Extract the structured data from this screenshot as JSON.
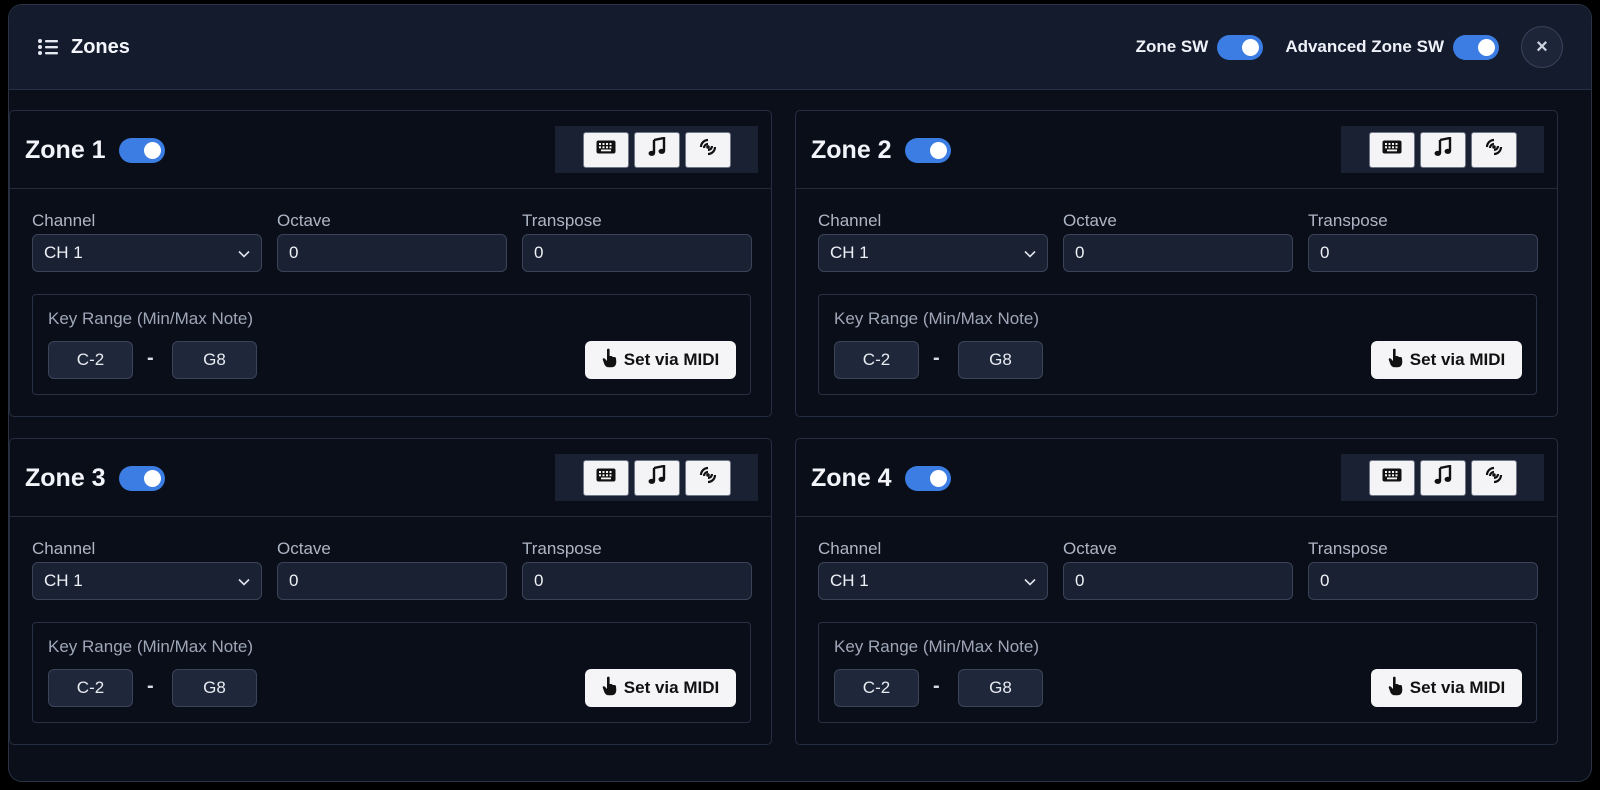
{
  "header": {
    "title": "Zones",
    "zone_sw_label": "Zone SW",
    "zone_sw_on": true,
    "advanced_sw_label": "Advanced Zone SW",
    "advanced_sw_on": true,
    "close_label": "×"
  },
  "labels": {
    "channel": "Channel",
    "octave": "Octave",
    "transpose": "Transpose",
    "key_range": "Key Range (Min/Max Note)",
    "dash": "-",
    "set_via_midi": "Set via MIDI"
  },
  "zones": [
    {
      "title": "Zone 1",
      "enabled": true,
      "channel": "CH 1",
      "octave": "0",
      "transpose": "0",
      "min_note": "C-2",
      "max_note": "G8"
    },
    {
      "title": "Zone 2",
      "enabled": true,
      "channel": "CH 1",
      "octave": "0",
      "transpose": "0",
      "min_note": "C-2",
      "max_note": "G8"
    },
    {
      "title": "Zone 3",
      "enabled": true,
      "channel": "CH 1",
      "octave": "0",
      "transpose": "0",
      "min_note": "C-2",
      "max_note": "G8"
    },
    {
      "title": "Zone 4",
      "enabled": true,
      "channel": "CH 1",
      "octave": "0",
      "transpose": "0",
      "min_note": "C-2",
      "max_note": "G8"
    }
  ],
  "icons": {
    "list": "list-icon",
    "keyboard": "keyboard-icon",
    "music": "music-note-icon",
    "wave": "signal-icon",
    "chevron": "chevron-down-icon",
    "pointer": "pointer-hand-icon"
  },
  "colors": {
    "accent": "#3b7de3",
    "background": "#0b0f1a",
    "header": "#141b2d"
  }
}
